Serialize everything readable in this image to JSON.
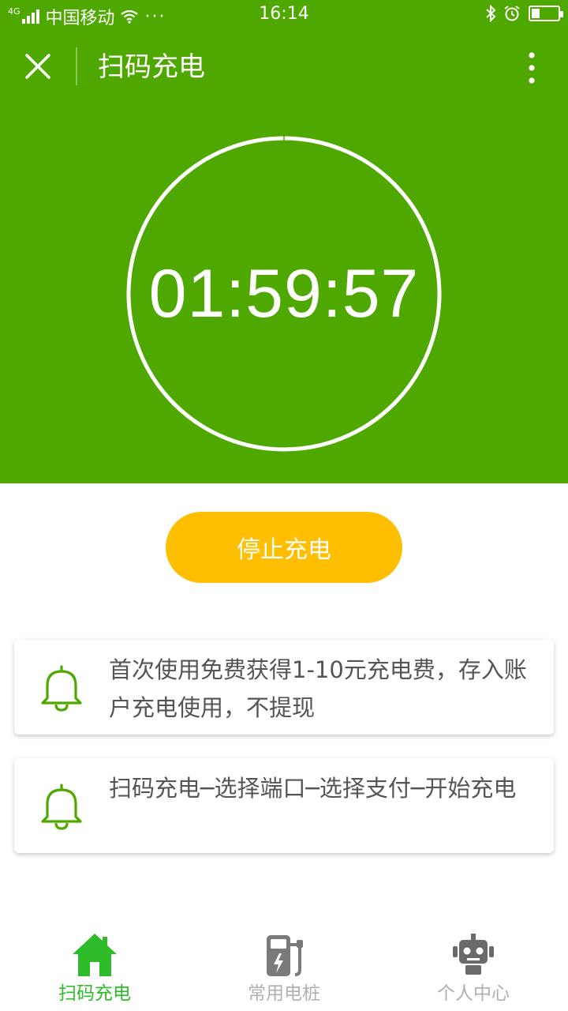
{
  "status_bar": {
    "network": "4G",
    "carrier": "中国移动",
    "more": "···",
    "time": "16:14",
    "battery_level": 0.3
  },
  "navbar": {
    "title": "扫码充电"
  },
  "timer": {
    "value": "01:59:57"
  },
  "stop_button": {
    "label": "停止充电",
    "color": "#ffbe00"
  },
  "notices": [
    {
      "text": "首次使用免费获得1-10元充电费，存入账户充电使用，不提现"
    },
    {
      "text": "扫码充电─选择端口─选择支付─开始充电"
    }
  ],
  "tabs": [
    {
      "label": "扫码充电",
      "icon": "home-icon",
      "active": true
    },
    {
      "label": "常用电桩",
      "icon": "charging-pile-icon",
      "active": false
    },
    {
      "label": "个人中心",
      "icon": "robot-icon",
      "active": false
    }
  ],
  "colors": {
    "brand_green": "#4ea800",
    "active_tab": "#2ebc2a",
    "inactive_tab": "#b0b0b0",
    "bell": "#4ea800"
  }
}
